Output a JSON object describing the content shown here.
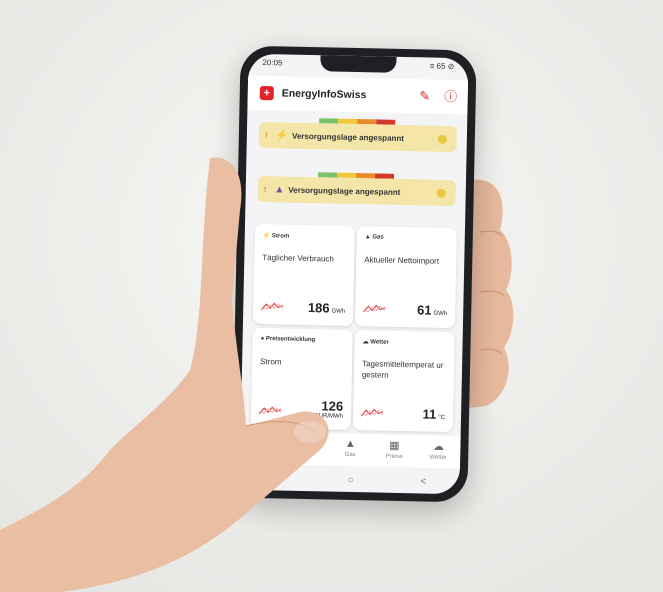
{
  "status": {
    "time": "20:05",
    "right": "≡ 65 ⊘"
  },
  "app": {
    "title": "EnergyInfoSwiss",
    "edit_icon": "pencil-icon",
    "info_icon": "info-icon",
    "logo_icon": "swiss-cross-icon"
  },
  "banners": [
    {
      "icon": "⚡",
      "text": "Versorgungslage angespannt"
    },
    {
      "icon": "▲",
      "text": "Versorgungslage angespannt"
    }
  ],
  "cards": [
    {
      "tag": "⚡ Strom",
      "label": "Täglicher Verbrauch",
      "value": "186",
      "unit": "GWh"
    },
    {
      "tag": "▲ Gas",
      "label": "Aktueller Nettoimport",
      "value": "61",
      "unit": "GWh"
    },
    {
      "tag": "● Preisentwicklung",
      "label": "Strom",
      "value": "126",
      "unit": "EUR/MWh"
    },
    {
      "tag": "☁ Wetter",
      "label": "Tagesmitteltemperat ur gestern",
      "value": "11",
      "unit": "°C"
    }
  ],
  "tabs": [
    {
      "label": "",
      "icon": "⚡"
    },
    {
      "label": "",
      "icon": "▲"
    },
    {
      "label": "Gas",
      "icon": "▲"
    },
    {
      "label": "Preise",
      "icon": "▦"
    },
    {
      "label": "Wetter",
      "icon": "☁"
    }
  ],
  "nav": {
    "recents": "|||",
    "home": "○",
    "back": "<"
  },
  "colors": {
    "accent": "#e1232a",
    "banner": "#f4e6a8",
    "dot": "#e8c63f"
  }
}
